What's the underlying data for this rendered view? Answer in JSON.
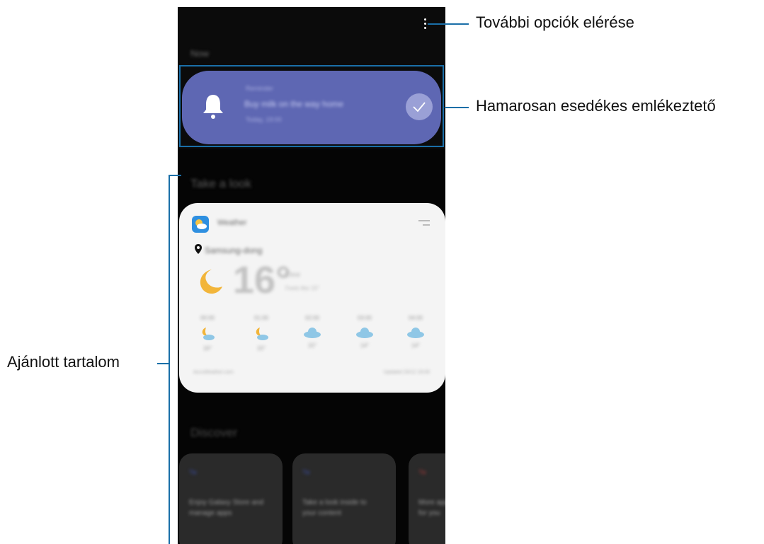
{
  "screen": {
    "section_now": "Now",
    "reminder": {
      "small_label": "Reminder",
      "title": "Buy milk on the way home",
      "time": "Today, 19:00"
    },
    "section_look": "Take a look",
    "weather": {
      "app_name": "Weather",
      "location": "Samsung-dong",
      "temperature": "16°",
      "condition": "Clear",
      "feels_like": "Feels like 15°",
      "forecast": [
        {
          "time": "00:00",
          "icon": "moon-cloud-icon",
          "temp": "16°"
        },
        {
          "time": "01:00",
          "icon": "moon-cloud-icon",
          "temp": "15°"
        },
        {
          "time": "02:00",
          "icon": "cloud-icon",
          "temp": "15°"
        },
        {
          "time": "03:00",
          "icon": "cloud-icon",
          "temp": "14°"
        },
        {
          "time": "04:00",
          "icon": "cloud-icon",
          "temp": "14°"
        }
      ],
      "source": "AccuWeather.com",
      "updated": "Updated 20/12 19:00"
    },
    "section_discover": "Discover",
    "discover_cards": [
      {
        "label": "Tip",
        "text": "Enjoy Galaxy Store and manage apps",
        "accent": "#3b4fa8"
      },
      {
        "label": "Tip",
        "text": "Take a look inside to your content",
        "accent": "#3b4fa8"
      },
      {
        "label": "Tip",
        "text": "More apps suggested for you",
        "accent": "#a83b3b"
      }
    ]
  },
  "callouts": {
    "more_options": "További opciók elérése",
    "upcoming_reminder": "Hamarosan esedékes emlékeztető",
    "recommended_content": "Ajánlott tartalom"
  }
}
